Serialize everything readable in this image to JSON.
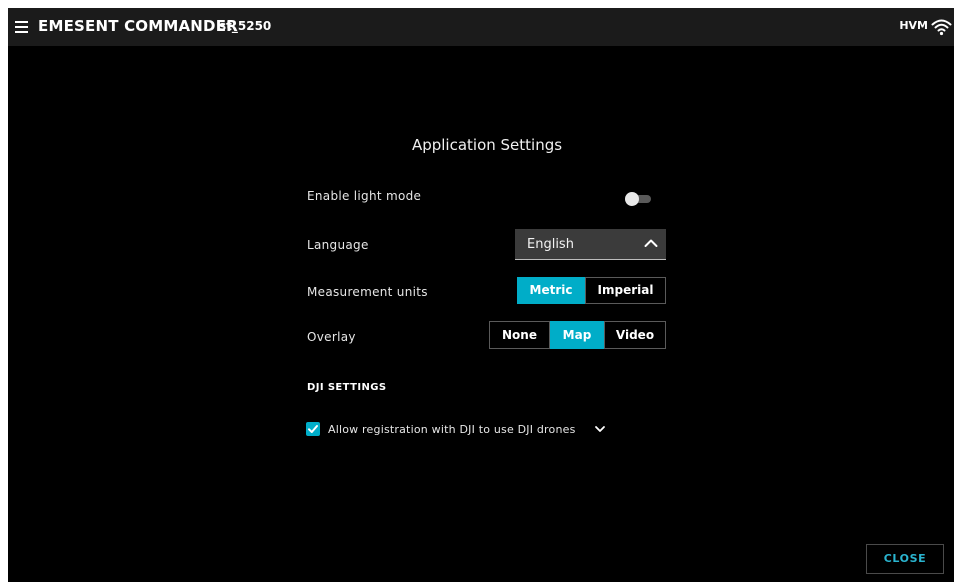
{
  "header": {
    "title": "EMESENT COMMANDER",
    "device_id": "st_5250",
    "mode": "HVM",
    "menu_icon": "hamburger-menu-icon",
    "wifi_icon": "wifi-icon"
  },
  "settings": {
    "title": "Application Settings",
    "light_mode": {
      "label": "Enable light mode",
      "enabled": false
    },
    "language": {
      "label": "Language",
      "value": "English",
      "icon": "chevron-up-icon"
    },
    "units": {
      "label": "Measurement units",
      "options": [
        "Metric",
        "Imperial"
      ],
      "selected": "Metric"
    },
    "overlay": {
      "label": "Overlay",
      "options": [
        "None",
        "Map",
        "Video"
      ],
      "selected": "Map"
    }
  },
  "dji": {
    "heading": "DJI SETTINGS",
    "registration": {
      "label": "Allow registration with DJI to use DJI drones",
      "checked": true,
      "icon": "chevron-down-icon"
    }
  },
  "footer": {
    "close_label": "CLOSE"
  },
  "colors": {
    "accent": "#00adc8",
    "background": "#000000",
    "topbar": "#1b1b1b"
  }
}
